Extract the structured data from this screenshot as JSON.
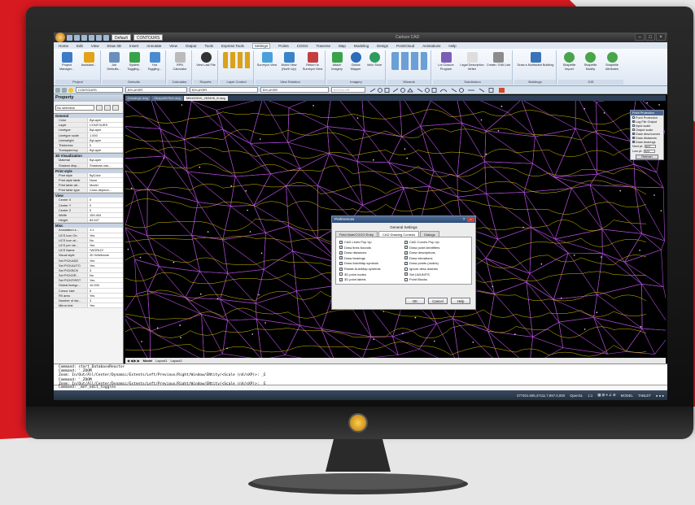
{
  "app": {
    "title": "Carlson CAD",
    "workspace": "Default",
    "layer_quick": "CONTOURS",
    "window_controls": [
      "–",
      "□",
      "×"
    ]
  },
  "ribbon": {
    "tabs": [
      "Home",
      "Edit",
      "View",
      "Draw 3D",
      "Insert",
      "Annotate",
      "View",
      "Output",
      "Tools",
      "Express Tools",
      "Settings",
      "Points",
      "COGO",
      "Traverse",
      "Map",
      "Modeling",
      "Design",
      "PointCloud",
      "Animations",
      "Help"
    ],
    "active_tab": "Settings",
    "groups": [
      {
        "label": "Project",
        "buttons": [
          "Project Manager...",
          "Assistant..."
        ]
      },
      {
        "label": "Defaults",
        "buttons": [
          "Job Defaults...",
          "System Toggling...",
          "Hot Toggling..."
        ]
      },
      {
        "label": "Calculator",
        "buttons": [
          "RPN Calculator"
        ]
      },
      {
        "label": "Reports",
        "buttons": [
          "View Last File"
        ]
      },
      {
        "label": "Layer Control",
        "buttons": []
      },
      {
        "label": "View Rotation",
        "buttons": [
          "Surveyor View",
          "World View (North Up)",
          "Return to Surveyor View"
        ]
      },
      {
        "label": "Imagery",
        "buttons": [
          "Attach Imagery",
          "Global Mapper",
          "Vellu Store"
        ]
      },
      {
        "label": "Wizards",
        "buttons": []
      },
      {
        "label": "Subdivision",
        "buttons": [
          "Lot Closure Program",
          "Legal Description Writer",
          "Create / Edit Lots"
        ]
      },
      {
        "label": "Buildings",
        "buttons": [
          "Draw a Multisided Building"
        ]
      },
      {
        "label": "GIS",
        "buttons": [
          "Shapefile Import",
          "Shapefile Modify",
          "Shapefile Attributes"
        ]
      }
    ]
  },
  "layerbar": {
    "layer": "CONTOURS",
    "color": "BYLAYER",
    "linetype": "BYLAYER",
    "lineweight": "BYLAYER",
    "plotstyle": "BYCOLOR"
  },
  "property": {
    "title": "Property",
    "selection": "No selection",
    "sections": [
      {
        "name": "General",
        "rows": [
          [
            "Color",
            "ByLayer"
          ],
          [
            "Layer",
            "CONTOURS"
          ],
          [
            "Linetype",
            "ByLayer"
          ],
          [
            "Linetype scale",
            "1.000"
          ],
          [
            "Lineweight",
            "ByLayer"
          ],
          [
            "Thickness",
            "0"
          ],
          [
            "Transparency",
            "ByLayer"
          ]
        ]
      },
      {
        "name": "3D Visualization",
        "rows": [
          [
            "Material",
            "ByLayer"
          ],
          [
            "Shadow disp...",
            "Shadows cas..."
          ]
        ]
      },
      {
        "name": "Print style",
        "rows": [
          [
            "Print style",
            "ByColor"
          ],
          [
            "Print style table",
            "None"
          ],
          [
            "Print table att...",
            "Model"
          ],
          [
            "Print table type",
            "Color-depend..."
          ]
        ]
      },
      {
        "name": "View",
        "rows": [
          [
            "Center X",
            "0"
          ],
          [
            "Center Y",
            "0"
          ],
          [
            "Center Z",
            "0"
          ],
          [
            "Width",
            "159.404"
          ],
          [
            "Height",
            "83.527"
          ]
        ]
      },
      {
        "name": "Misc",
        "rows": [
          [
            "Annotation s...",
            "1:1"
          ],
          [
            "UCS icon On",
            "Yes"
          ],
          [
            "UCS icon at...",
            "No"
          ],
          [
            "UCS per vie...",
            "Yes"
          ],
          [
            "UCS Name",
            "*WORLD*"
          ],
          [
            "Visual style",
            "2D Wireframe"
          ],
          [
            "Set PICKADD",
            "Yes"
          ],
          [
            "Set PICKAUTO",
            "Yes"
          ],
          [
            "Set PICKBOX",
            "3"
          ],
          [
            "Set PICKDR...",
            "No"
          ],
          [
            "Set PICKFIRST",
            "Yes"
          ],
          [
            "Global linetyp...",
            "10.000"
          ],
          [
            "Cursor size",
            "5"
          ],
          [
            "Fill area",
            "Yes"
          ],
          [
            "Number of dw...",
            "3"
          ],
          [
            "Mirror text",
            "Yes"
          ]
        ]
      }
    ]
  },
  "doc_tabs": [
    {
      "label": "Drawing1.dwg",
      "active": false
    },
    {
      "label": "ShapefileTest.dwg",
      "active": false
    },
    {
      "label": "MN100910_283406_8.dwg",
      "active": true
    }
  ],
  "layout_tabs": [
    "Model",
    "Layout1",
    "Layout2"
  ],
  "dialog": {
    "title": "Preferences",
    "group_title": "General Settings",
    "tabs": [
      "Field Note/COGO Entry",
      "CAD Drawing Controls",
      "Dialogs"
    ],
    "active_tab": "CAD Drawing Controls",
    "left_checks": [
      {
        "label": "CAD Lines Pop Up",
        "checked": true
      },
      {
        "label": "Draw lines bounds",
        "checked": true
      },
      {
        "label": "Draw distances",
        "checked": true
      },
      {
        "label": "Draw bearings",
        "checked": true
      },
      {
        "label": "Draw AutoMap symbols",
        "checked": true
      },
      {
        "label": "Rotate AutoMap symbols",
        "checked": true
      },
      {
        "label": "3D point nodes",
        "checked": false
      },
      {
        "label": "3D point labels",
        "checked": true
      }
    ],
    "right_checks": [
      {
        "label": "CAD Curves Pop Up",
        "checked": true
      },
      {
        "label": "Draw point identifiers",
        "checked": true
      },
      {
        "label": "Draw descriptions",
        "checked": true
      },
      {
        "label": "Draw elevations",
        "checked": true
      },
      {
        "label": "Draw points (nodes)",
        "checked": true
      },
      {
        "label": "Ignore desc dashes",
        "checked": false
      },
      {
        "label": "Set LWUNITS",
        "checked": true
      },
      {
        "label": "Point Blocks",
        "checked": false
      }
    ],
    "buttons": [
      "OK",
      "Cancel",
      "Help"
    ]
  },
  "right_panel": {
    "title": "Point Protection",
    "checks": [
      {
        "label": "Point Protection",
        "checked": false
      },
      {
        "label": "Log File Output",
        "checked": true
      },
      {
        "label": "Input scale",
        "checked": false
      },
      {
        "label": "Output scale",
        "checked": false
      },
      {
        "label": "Draw desc/curves",
        "checked": true
      },
      {
        "label": "Draw distances",
        "checked": true
      },
      {
        "label": "Draw bearings",
        "checked": true
      }
    ],
    "next_pt_label": "Next pt:",
    "next_pt_value": "423",
    "low_pt_label": "Low pt:",
    "low_pt_value": "423",
    "refresh": "Refresh"
  },
  "command": {
    "lines": [
      "Command: start_DatabaseReactor",
      "Command: '_ZOOM",
      "Zoom: In/Out/All/Center/Dynamic/Extents/Left/Previous/Right/Window/ENtity/<Scale (nX/nXP)>: _E",
      "Command: '_ZOOM",
      "Zoom: In/Out/All/Center/Dynamic/Extents/Left/Previous/Right/Window/ENtity/<Scale (nX/nXP)>: _E"
    ],
    "input": "Command:  _mnf_edit_toggles"
  },
  "status": {
    "coords": "277401.605,47111.7,957.0,000",
    "renderer": "OpenGL",
    "scale": "1:1",
    "mode": "MODEL",
    "tablet": "TABLET"
  },
  "colors": {
    "accent_red": "#d71920",
    "ribbon_bg": "#dce6f3",
    "drawing_bg": "#000000",
    "tin_lines": "#b04bd6",
    "contour_lines": "#d8c100"
  }
}
